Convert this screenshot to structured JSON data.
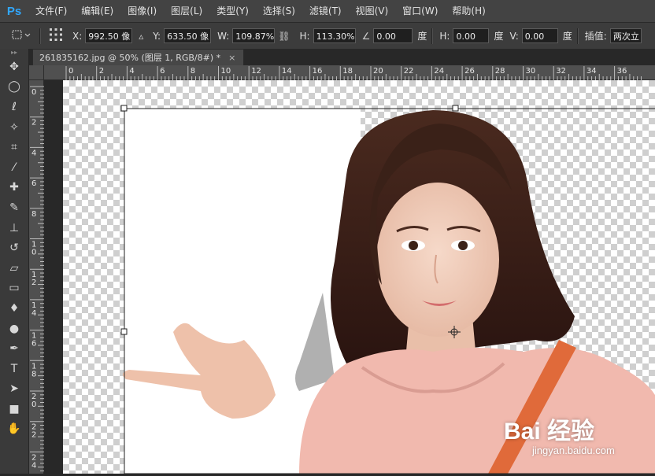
{
  "app": {
    "logo_text": "Ps"
  },
  "menu": {
    "items": [
      "文件(F)",
      "编辑(E)",
      "图像(I)",
      "图层(L)",
      "类型(Y)",
      "选择(S)",
      "滤镜(T)",
      "视图(V)",
      "窗口(W)",
      "帮助(H)"
    ]
  },
  "options": {
    "x_label": "X:",
    "x_value": "992.50 像",
    "y_label": "Y:",
    "y_value": "633.50 像",
    "w_label": "W:",
    "w_value": "109.87%",
    "h_label": "H:",
    "h_value": "113.30%",
    "angle_value": "0.00",
    "angle_unit": "度",
    "hskew_label": "H:",
    "hskew_value": "0.00",
    "hskew_unit": "度",
    "vskew_label": "V:",
    "vskew_value": "0.00",
    "vskew_unit": "度",
    "interp_label": "插值:",
    "interp_value": "两次立"
  },
  "document": {
    "tab_title": "261835162.jpg @ 50% (图层 1, RGB/8#) *",
    "close_glyph": "×"
  },
  "rulers": {
    "horizontal_ticks": [
      "0",
      "2",
      "4",
      "6",
      "8",
      "10",
      "12",
      "14",
      "16",
      "18",
      "20",
      "22",
      "24",
      "26",
      "28",
      "30",
      "32",
      "34",
      "36"
    ],
    "vertical_ticks": [
      "0",
      "2",
      "4",
      "6",
      "8",
      "10",
      "12",
      "14",
      "16",
      "18",
      "20",
      "22",
      "24"
    ]
  },
  "watermark": {
    "logo_text": "Bai 经验",
    "url": "jingyan.baidu.com"
  },
  "colors": {
    "hair": "#3a2118",
    "skin": "#f0c9b3",
    "hoodie": "#f1b9ae",
    "strap": "#e06a3a"
  }
}
